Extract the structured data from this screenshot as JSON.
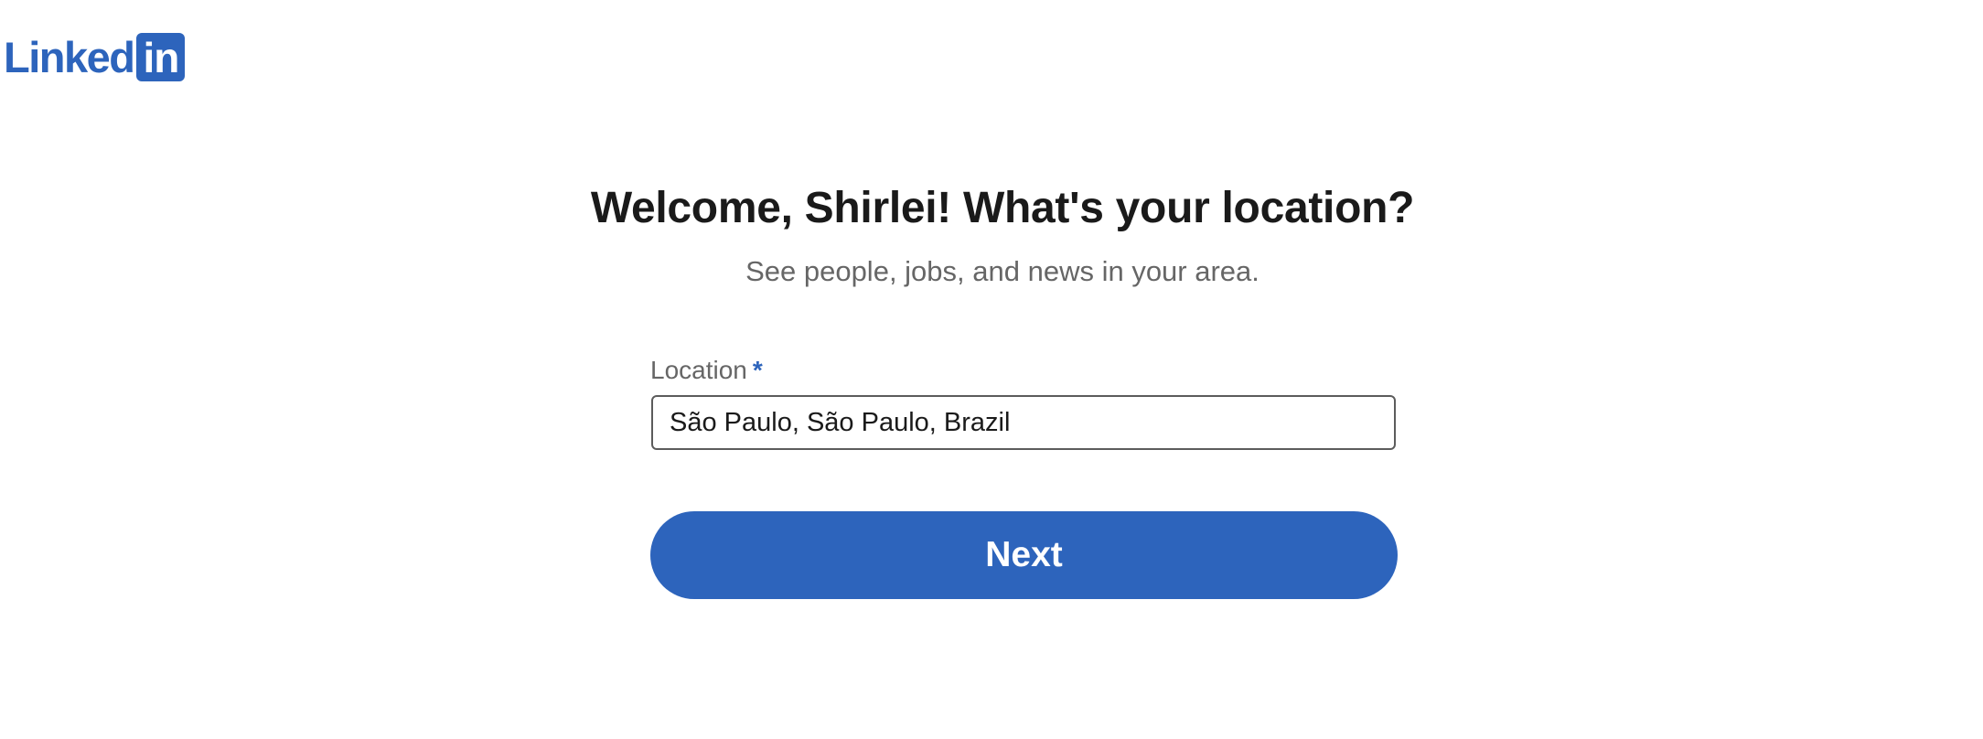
{
  "header": {
    "logo_word": "Linked",
    "logo_box_text": "in",
    "brand_color": "#2d64bc"
  },
  "main": {
    "title": "Welcome, Shirlei! What's your location?",
    "subtitle": "See people, jobs, and news in your area."
  },
  "form": {
    "location_label": "Location",
    "required_marker": "*",
    "location_value": "São Paulo, São Paulo, Brazil",
    "next_label": "Next"
  },
  "colors": {
    "accent": "#2d64bc",
    "title_text": "#1a1a1a",
    "muted_text": "#666666",
    "input_border": "#5c5c5c"
  }
}
